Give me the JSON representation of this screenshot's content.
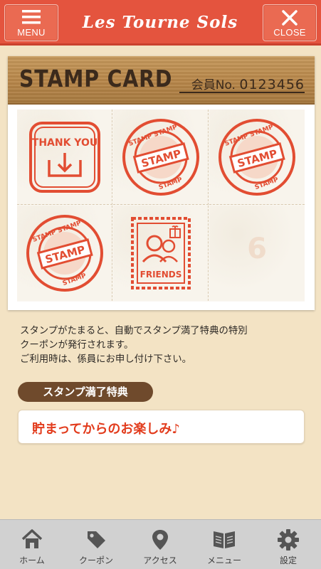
{
  "header": {
    "menu_label": "MENU",
    "close_label": "CLOSE",
    "brand": "Les Tourne Sols"
  },
  "card": {
    "title": "STAMP CARD",
    "member_prefix": "会員No.",
    "member_number": "0123456",
    "cells": [
      {
        "kind": "thank-you",
        "text": "THANK YOU"
      },
      {
        "kind": "stamp",
        "text": "STAMP"
      },
      {
        "kind": "stamp",
        "text": "STAMP"
      },
      {
        "kind": "stamp",
        "text": "STAMP"
      },
      {
        "kind": "friends",
        "text": "FRIENDS"
      },
      {
        "kind": "empty",
        "text": "6"
      }
    ]
  },
  "info": {
    "line1": "スタンプがたまると、自動でスタンプ満了特典の特別",
    "line2": "クーポンが発行されます。",
    "line3": "ご利用時は、係員にお申し付け下さい。"
  },
  "reward": {
    "tag": "スタンプ満了特典",
    "text": "貯まってからのお楽しみ♪"
  },
  "nav": [
    {
      "label": "ホーム",
      "icon": "home-icon"
    },
    {
      "label": "クーポン",
      "icon": "coupon-tag-icon"
    },
    {
      "label": "アクセス",
      "icon": "map-pin-icon"
    },
    {
      "label": "メニュー",
      "icon": "menu-book-icon"
    },
    {
      "label": "設定",
      "icon": "gear-icon"
    }
  ],
  "colors": {
    "header": "#e4543e",
    "stamp": "#e24d32",
    "reward_text": "#e23b1c",
    "tag_bg": "#6f4a2c"
  }
}
